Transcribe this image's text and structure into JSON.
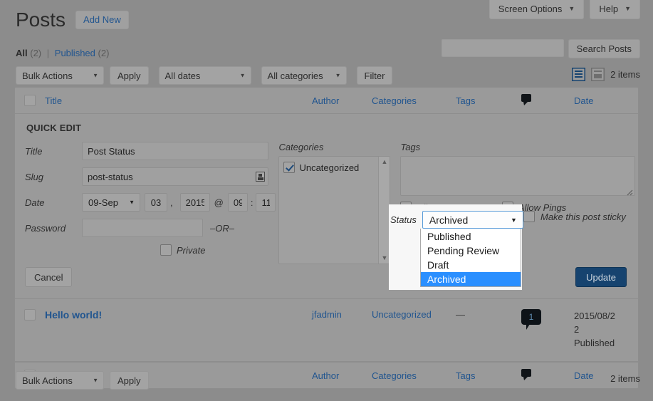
{
  "screen_meta": {
    "screen_options_label": "Screen Options",
    "help_label": "Help",
    "caret": "▼"
  },
  "header": {
    "title": "Posts",
    "add_new_label": "Add New"
  },
  "status_links": {
    "all_label": "All",
    "all_count": "(2)",
    "separator": "|",
    "published_label": "Published",
    "published_count": "(2)"
  },
  "search": {
    "value": "",
    "placeholder": "",
    "submit_label": "Search Posts"
  },
  "tablenav_top": {
    "bulk_actions_label": "Bulk Actions",
    "apply_label": "Apply",
    "all_dates_label": "All dates",
    "all_categories_label": "All categories",
    "filter_label": "Filter",
    "list_view_icon": "list-view-icon",
    "excerpt_view_icon": "excerpt-view-icon",
    "displaying_num": "2 items"
  },
  "table": {
    "columns": {
      "title": "Title",
      "author": "Author",
      "categories": "Categories",
      "tags": "Tags",
      "comments_icon": "comment-bubble-icon",
      "date": "Date"
    },
    "rows": [
      {
        "title": "Hello world!",
        "author": "jfadmin",
        "categories": "Uncategorized",
        "tags": "—",
        "comments": "1",
        "date_line1": "2015/08/2",
        "date_line2": "2",
        "date_line3": "Published"
      }
    ]
  },
  "quick_edit": {
    "legend": "QUICK EDIT",
    "title_label": "Title",
    "title_value": "Post Status",
    "slug_label": "Slug",
    "slug_value": "post-status",
    "slug_icon": "keyboard-icon",
    "date_label": "Date",
    "month_value": "09-Sep",
    "day_value": "03",
    "comma": ",",
    "year_value": "2015",
    "at_symbol": "@",
    "hour_value": "09",
    "colon": ":",
    "minute_value": "11",
    "password_label": "Password",
    "password_value": "",
    "or_text": "–OR–",
    "private_label": "Private",
    "cancel_label": "Cancel",
    "update_label": "Update",
    "categories_label": "Categories",
    "category_items": [
      {
        "label": "Uncategorized",
        "checked": true
      }
    ],
    "tags_label": "Tags",
    "tags_value": "",
    "allow_comments_label": "Allow Comments",
    "allow_pings_label": "Allow Pings",
    "sticky_label": "Make this post sticky",
    "status_label": "Status",
    "status_value": "Archived",
    "status_options": [
      "Published",
      "Pending Review",
      "Draft",
      "Archived"
    ],
    "status_selected_index": 3
  },
  "tablenav_bottom": {
    "bulk_actions_label": "Bulk Actions",
    "apply_label": "Apply",
    "displaying_num": "2 items"
  },
  "colors": {
    "page_bg": "#8c8c8c",
    "table_bg": "#9a9a9a",
    "link": "#21558f",
    "primary_button": "#16436f",
    "select_highlight": "#2a8fff",
    "select_focus_border": "#5b9dd9"
  }
}
